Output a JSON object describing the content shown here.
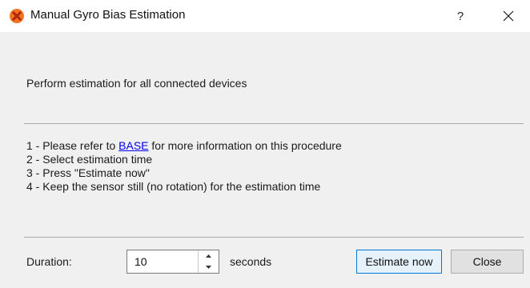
{
  "window": {
    "title": "Manual Gyro Bias Estimation",
    "help_label": "?"
  },
  "heading": "Perform estimation for all connected devices",
  "steps": {
    "step1_prefix": "1 - Please refer to ",
    "step1_link": "BASE",
    "step1_suffix": " for more information on this procedure",
    "step2": "2 - Select estimation time",
    "step3": "3 - Press \"Estimate now\"",
    "step4": "4 - Keep the sensor still (no rotation) for the estimation time"
  },
  "duration": {
    "label": "Duration:",
    "value": "10",
    "unit": "seconds"
  },
  "buttons": {
    "estimate": "Estimate now",
    "close": "Close"
  },
  "icons": {
    "app": "xsens-logo-icon",
    "close": "close-icon",
    "spin_up": "chevron-up-icon",
    "spin_down": "chevron-down-icon"
  },
  "colors": {
    "app_icon": "#f47321",
    "link": "#0000ee",
    "default_button_border": "#0078d7",
    "default_button_bg": "#e5f1fb",
    "dialog_bg": "#f0f0f0"
  }
}
